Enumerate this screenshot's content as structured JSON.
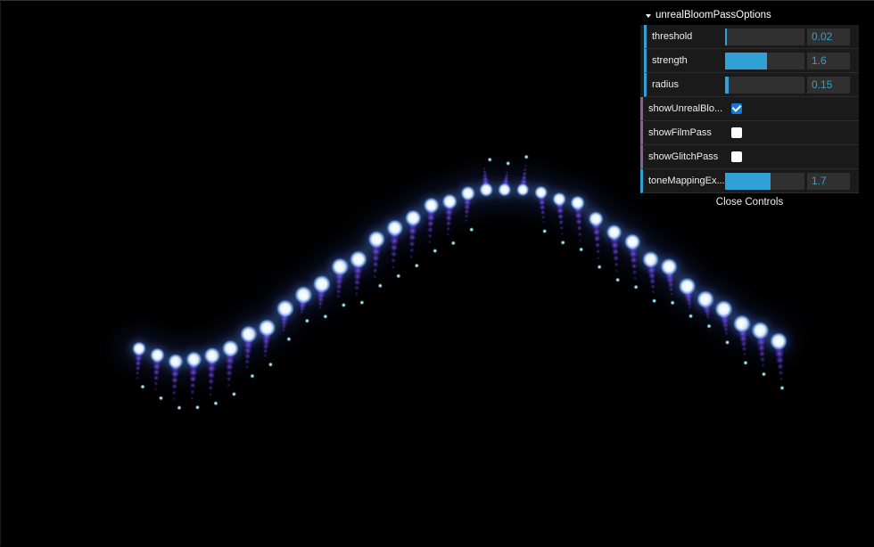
{
  "gui": {
    "folder_title": "unrealBloomPassOptions",
    "controls": [
      {
        "label": "threshold",
        "value": "0.02",
        "fraction": 0.02,
        "type": "number"
      },
      {
        "label": "strength",
        "value": "1.6",
        "fraction": 0.53,
        "type": "number"
      },
      {
        "label": "radius",
        "value": "0.15",
        "fraction": 0.04,
        "type": "number"
      }
    ],
    "toggles": [
      {
        "label": "showUnrealBlo...",
        "checked": true
      },
      {
        "label": "showFilmPass",
        "checked": false
      },
      {
        "label": "showGlitchPass",
        "checked": false
      }
    ],
    "tone": {
      "label": "toneMappingEx...",
      "value": "1.7",
      "fraction": 0.57
    },
    "close_label": "Close Controls",
    "accent_color": "#2fa1d6",
    "bool_color": "#806787"
  },
  "scene": {
    "description_icon": "glowing-particle-wave",
    "glow_color": "#7b4dff",
    "core_color": "#ffffff"
  }
}
